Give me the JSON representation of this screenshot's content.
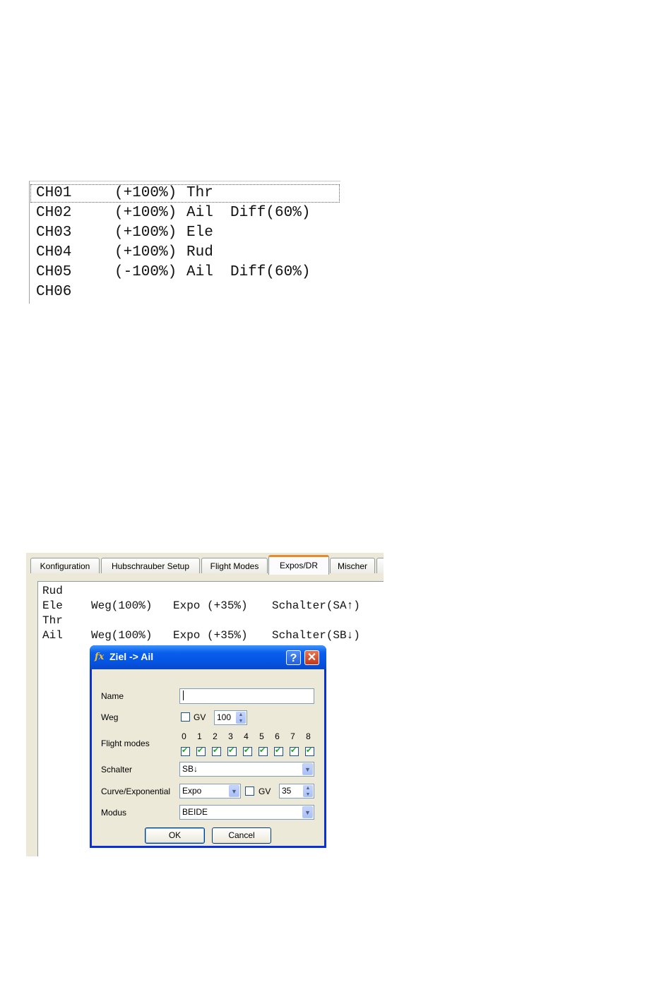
{
  "channels": [
    {
      "name": "CH01",
      "weight": "(+100%)",
      "source": "Thr",
      "extra": ""
    },
    {
      "name": "CH02",
      "weight": "(+100%)",
      "source": "Ail",
      "extra": "Diff(60%)"
    },
    {
      "name": "CH03",
      "weight": "(+100%)",
      "source": "Ele",
      "extra": ""
    },
    {
      "name": "CH04",
      "weight": "(+100%)",
      "source": "Rud",
      "extra": ""
    },
    {
      "name": "CH05",
      "weight": "(-100%)",
      "source": "Ail",
      "extra": "Diff(60%)"
    },
    {
      "name": "CH06",
      "weight": "",
      "source": "",
      "extra": ""
    }
  ],
  "tabs": [
    {
      "label": "Konfiguration"
    },
    {
      "label": "Hubschrauber Setup"
    },
    {
      "label": "Flight Modes"
    },
    {
      "label": "Expos/DR",
      "active": true
    },
    {
      "label": "Mischer"
    }
  ],
  "expos": [
    {
      "input": "Rud",
      "weight": "",
      "expo": "",
      "switch": ""
    },
    {
      "input": "Ele",
      "weight": "Weg(100%)",
      "expo": "Expo (+35%)",
      "switch": "Schalter(SA↑)"
    },
    {
      "input": "Thr",
      "weight": "",
      "expo": "",
      "switch": ""
    },
    {
      "input": "Ail",
      "weight": "Weg(100%)",
      "expo": "Expo (+35%)",
      "switch": "Schalter(SB↓)"
    }
  ],
  "dialog": {
    "title": "Ziel -> Ail",
    "icon": "fx",
    "help": "?",
    "close": "✕",
    "name_label": "Name",
    "name_value": "",
    "weg_label": "Weg",
    "gv_label": "GV",
    "weg_value": "100",
    "flight_modes_label": "Flight modes",
    "flight_modes": [
      "0",
      "1",
      "2",
      "3",
      "4",
      "5",
      "6",
      "7",
      "8"
    ],
    "schalter_label": "Schalter",
    "schalter_value": "SB↓",
    "curve_label": "Curve/Exponential",
    "curve_type": "Expo",
    "curve_gv_label": "GV",
    "curve_value": "35",
    "modus_label": "Modus",
    "modus_value": "BEIDE",
    "ok_label": "OK",
    "cancel_label": "Cancel"
  },
  "colors": {
    "accent_tab": "#e68b2c",
    "titlebar": "#0454e2",
    "check": "#21a121"
  }
}
